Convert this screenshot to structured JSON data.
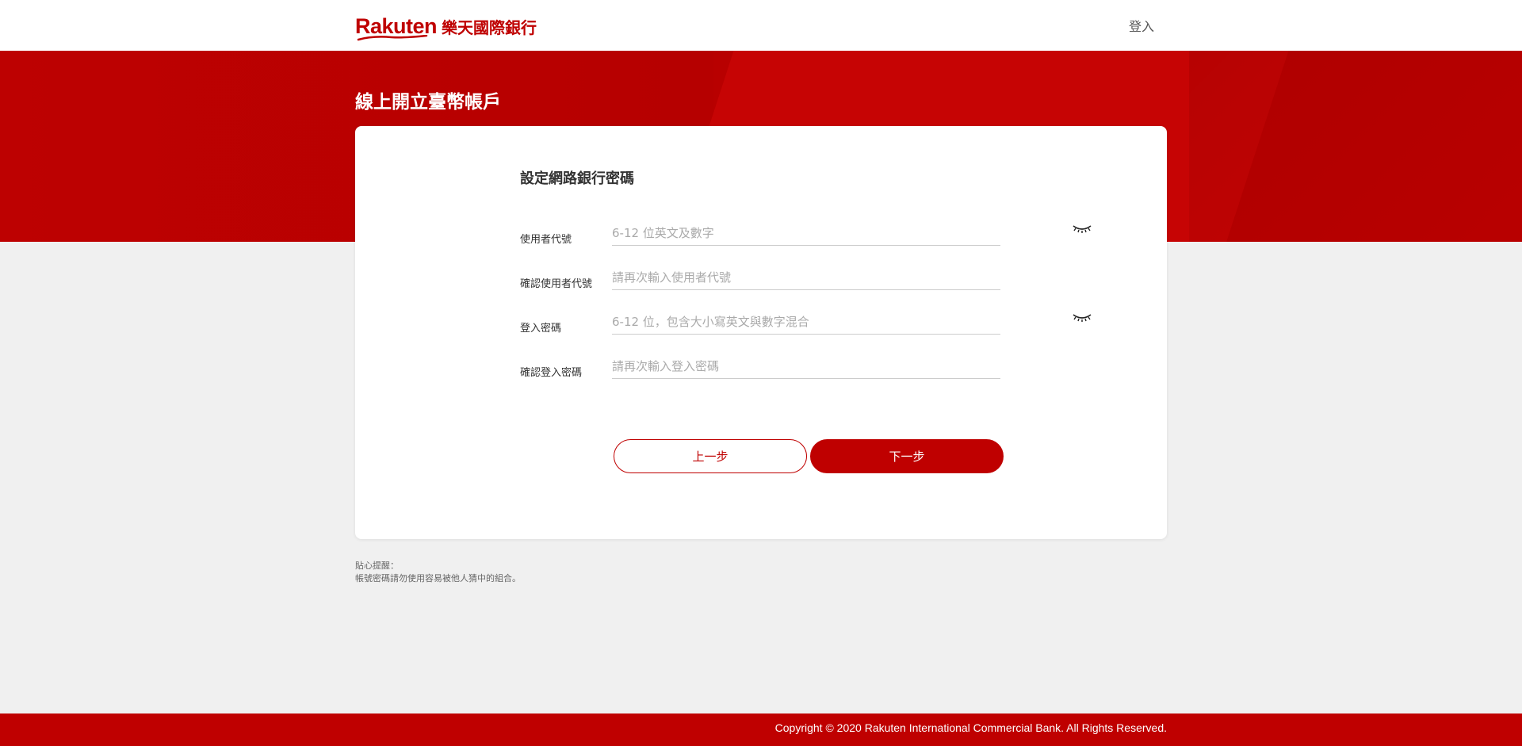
{
  "header": {
    "logo_en": "Rakuten",
    "logo_zh": "樂天國際銀行",
    "login_label": "登入"
  },
  "hero": {
    "title": "線上開立臺幣帳戶"
  },
  "form": {
    "title": "設定網路銀行密碼",
    "fields": [
      {
        "label": "使用者代號",
        "placeholder": "6-12 位英文及數字",
        "has_eye": true
      },
      {
        "label": "確認使用者代號",
        "placeholder": "請再次輸入使用者代號",
        "has_eye": false
      },
      {
        "label": "登入密碼",
        "placeholder": "6-12 位，包含大小寫英文與數字混合",
        "has_eye": true
      },
      {
        "label": "確認登入密碼",
        "placeholder": "請再次輸入登入密碼",
        "has_eye": false
      }
    ],
    "prev_label": "上一步",
    "next_label": "下一步"
  },
  "tips": {
    "title": "貼心提醒：",
    "text": "帳號密碼請勿使用容易被他人猜中的組合。"
  },
  "footer": {
    "copyright": "Copyright © 2020 Rakuten International Commercial Bank. All Rights Reserved."
  },
  "colors": {
    "brand": "#bf0000",
    "background": "#f0f0f0"
  },
  "icons": {
    "show_password": "eye-closed-icon"
  }
}
